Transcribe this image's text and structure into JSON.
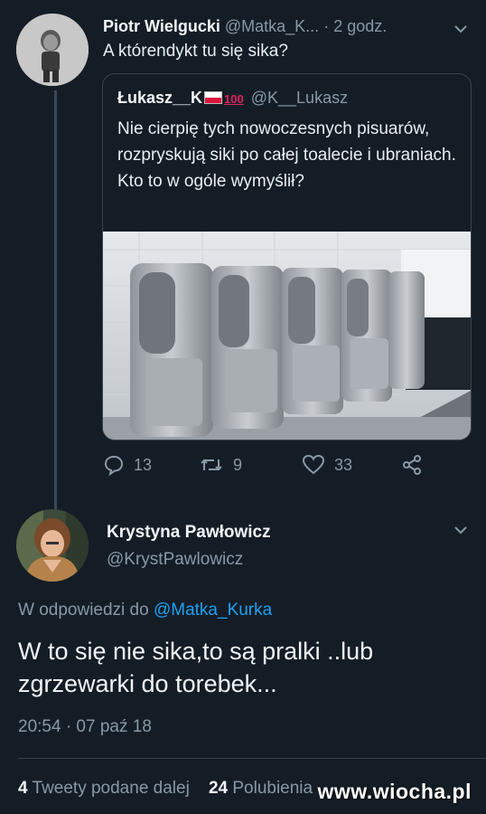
{
  "tweet1": {
    "name": "Piotr Wielgucki",
    "handle": "@Matka_K...",
    "separator": "·",
    "time": "2 godz.",
    "text": "A którendykt tu się sika?"
  },
  "quoted": {
    "name": "Łukasz__K",
    "badge": "100",
    "handle": "@K__Lukasz",
    "text": "Nie cierpię tych nowoczesnych pisuarów, rozpryskują siki po całej toalecie i ubraniach. Kto to w ogóle wymyślił?"
  },
  "actions": {
    "replies": "13",
    "retweets": "9",
    "likes": "33"
  },
  "tweet2": {
    "name": "Krystyna Pawłowicz",
    "handle": "@KrystPawlowicz",
    "reply_prefix": "W odpowiedzi do ",
    "reply_to": "@Matka_Kurka",
    "text": "W to się nie sika,to są pralki ..lub zgrzewarki do torebek...",
    "timestamp": "20:54 · 07 paź 18",
    "retweet_count": "4",
    "retweet_label": "Tweety podane dalej",
    "like_count": "24",
    "like_label": "Polubienia"
  },
  "watermark": "www.wiocha.pl",
  "colors": {
    "background": "#141d26",
    "link": "#1da1f2",
    "muted": "#8899a6",
    "border": "#38444d"
  },
  "icons": [
    "chevron-down-icon",
    "reply-icon",
    "retweet-icon",
    "heart-icon",
    "share-icon",
    "poland-flag-icon",
    "hundred-points-icon"
  ]
}
